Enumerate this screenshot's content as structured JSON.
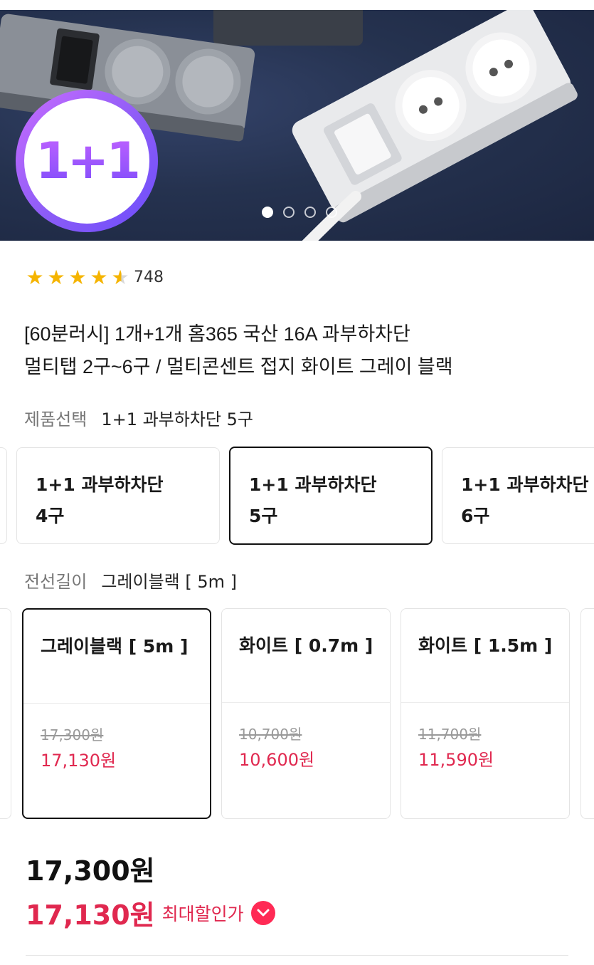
{
  "hero": {
    "badge_text": "1+1",
    "carousel": {
      "total": 4,
      "active_index": 0
    }
  },
  "rating": {
    "value": 4.5,
    "max": 5,
    "count": "748"
  },
  "product": {
    "title_lines": [
      "[60분러시] 1개+1개 홈365 국산 16A 과부하차단",
      "멀티탭 2구~6구 / 멀티콘센트 접지 화이트 그레이 블랙"
    ]
  },
  "product_option": {
    "label": "제품선택",
    "selected": "1+1 과부하차단 5구",
    "items": [
      {
        "line1": "1+1 과부하차단",
        "line2": "4구",
        "selected": false
      },
      {
        "line1": "1+1 과부하차단",
        "line2": "5구",
        "selected": true
      },
      {
        "line1": "1+1 과부하차단",
        "line2": "6구",
        "selected": false
      }
    ]
  },
  "cable_option": {
    "label": "전선길이",
    "selected": "그레이블랙 [ 5m ]",
    "items": [
      {
        "name": "그레이블랙 [ 5m ]",
        "original_price": "17,300원",
        "sale_price": "17,130원",
        "selected": true
      },
      {
        "name": "화이트 [ 0.7m ]",
        "original_price": "10,700원",
        "sale_price": "10,600원",
        "selected": false
      },
      {
        "name": "화이트 [ 1.5m ]",
        "original_price": "11,700원",
        "sale_price": "11,590원",
        "selected": false
      }
    ]
  },
  "price": {
    "original": "17,300원",
    "sale": "17,130원",
    "max_discount_label": "최대할인가"
  },
  "colors": {
    "accent_red": "#e0284f",
    "star_gold": "#f5b400",
    "badge_purple": "#8b5cf6"
  }
}
